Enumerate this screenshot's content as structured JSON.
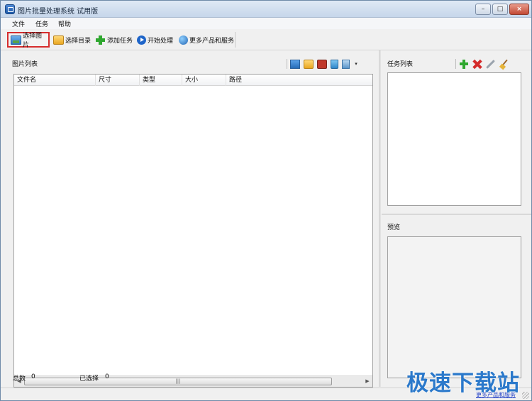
{
  "window": {
    "title": "图片批量处理系统 试用版",
    "controls": {
      "minimize": "–",
      "maximize": "□",
      "close": "×"
    }
  },
  "menu": {
    "items": [
      {
        "label": "文件"
      },
      {
        "label": "任务"
      },
      {
        "label": "帮助"
      }
    ]
  },
  "toolbar": {
    "select_image": "选择图片",
    "select_dir": "选择目录",
    "add_task": "添加任务",
    "start": "开始处理",
    "more": "更多产品和服务",
    "selected_button": "select_image",
    "highlight_color": "#d62d2d"
  },
  "image_list": {
    "title": "图片列表",
    "columns": [
      "文件名",
      "尺寸",
      "类型",
      "大小",
      "路径"
    ],
    "rows": [],
    "scroll_grip": "|||",
    "tools": [
      "screen-icon",
      "folder-icon",
      "printer-icon",
      "recycle-bin-icon",
      "document-icon",
      "dropdown-icon"
    ]
  },
  "status": {
    "total_label": "总数",
    "total_value": "0",
    "selected_label": "已选择",
    "selected_value": "0"
  },
  "task_list": {
    "title": "任务列表",
    "tools": [
      "add-icon",
      "delete-icon",
      "wrench-icon",
      "broom-icon"
    ]
  },
  "preview": {
    "title": "预览"
  },
  "statusbar": {
    "link": "更多产品和服务"
  },
  "watermark": {
    "text": "极速下载站"
  }
}
